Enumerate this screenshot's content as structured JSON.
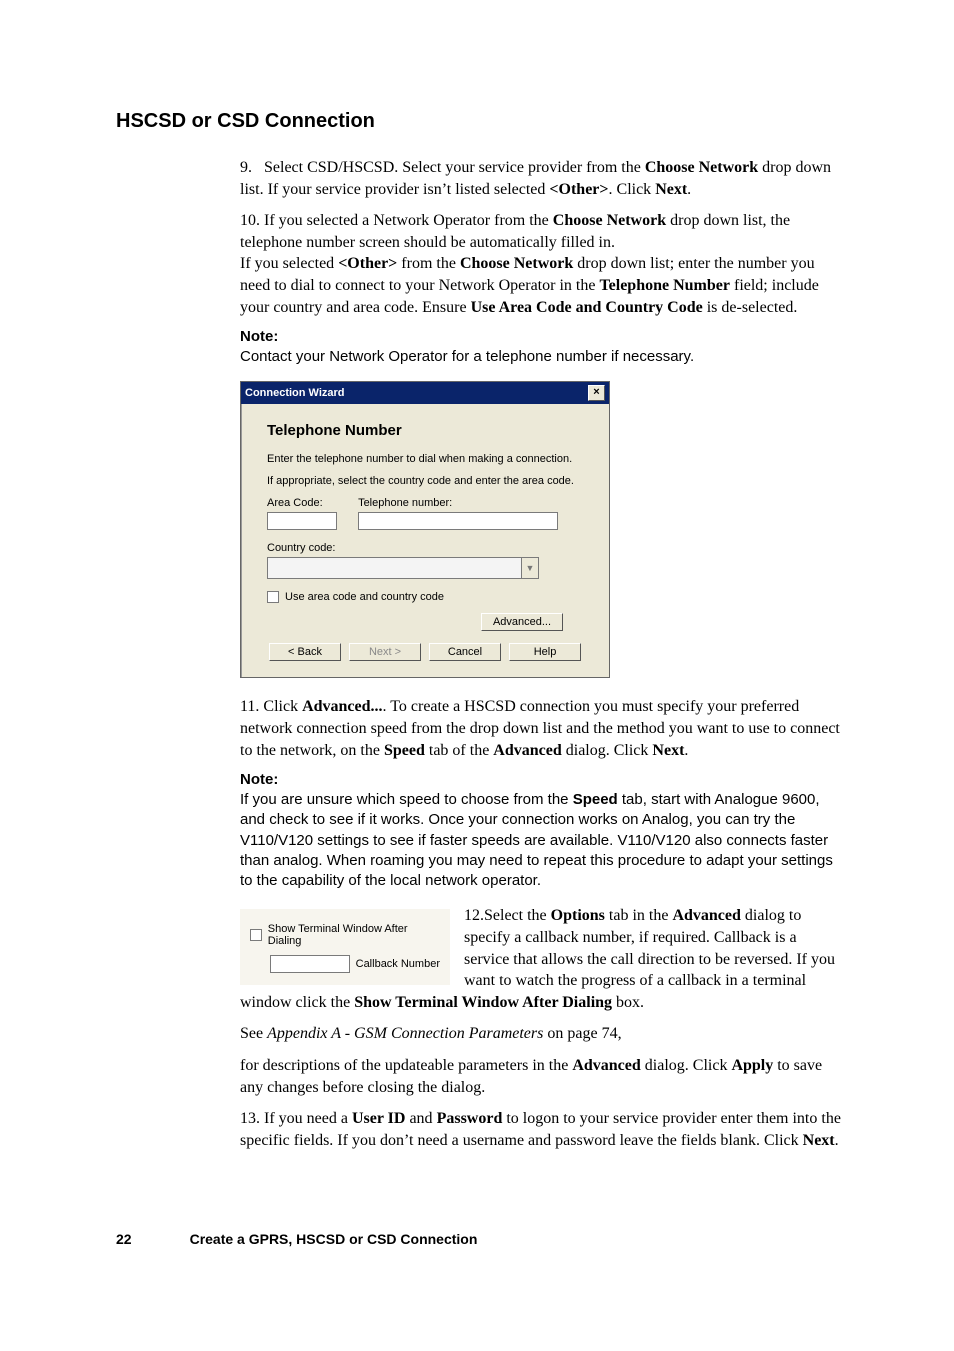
{
  "page_number": "22",
  "footer_title": "Create a GPRS, HSCSD or CSD Connection",
  "section_title": "HSCSD or CSD Connection",
  "step9_a": "Select CSD/HSCSD. Select your service provider from the ",
  "step9_b": "Choose Network",
  "step9_c": " drop down list. If your service provider isn’t listed selected ",
  "step9_d": "<Other>",
  "step9_e": ". Click ",
  "step9_f": "Next",
  "step9_g": ".",
  "step10_a": "If you selected a Network Operator from the ",
  "step10_b": "Choose Network",
  "step10_c": " drop down list, the telephone number screen should be automatically filled in.",
  "step10_d": "If you selected ",
  "step10_e": "<Other>",
  "step10_f": " from the ",
  "step10_g": "Choose Network",
  "step10_h": " drop down list; enter the number you need to dial to connect to your Network Operator in the ",
  "step10_i": "Telephone Number",
  "step10_j": " field; include your country and area code. Ensure ",
  "step10_k": "Use Area Code and Country Code",
  "step10_l": " is de-selected.",
  "note1_label": "Note:",
  "note1_body": "Contact your Network Operator for a telephone number if necessary.",
  "dialog": {
    "title": "Connection Wizard",
    "close": "×",
    "heading": "Telephone Number",
    "line1": "Enter the telephone number to dial when making a connection.",
    "line2": "If appropriate, select the country code and enter the area code.",
    "area_code_label": "Area Code:",
    "telephone_label": "Telephone number:",
    "country_label": "Country code:",
    "use_area_label": "Use area code and country code",
    "advanced_btn": "Advanced...",
    "back_btn": "< Back",
    "next_btn": "Next >",
    "cancel_btn": "Cancel",
    "help_btn": "Help"
  },
  "step11_a": "Click ",
  "step11_b": "Advanced...",
  "step11_c": ". To create a HSCSD connection you must specify your preferred network connection speed from the drop down list and the method you want to use to connect to the network, on the ",
  "step11_d": "Speed",
  "step11_e": " tab of the ",
  "step11_f": "Advanced",
  "step11_g": " dialog. Click ",
  "step11_h": "Next",
  "step11_i": ".",
  "note2_label": "Note:",
  "note2_body_a": "If you are unsure which speed to choose from the ",
  "note2_body_b": "Speed",
  "note2_body_c": " tab, start with Analogue 9600, and check to see if it works. Once your connection works on Analog, you can try the V110/V120 settings to see if faster speeds are available. V110/V120 also connects faster than analog. When roaming you may need to repeat this procedure to adapt your settings to the capability of the local network operator.",
  "options_snippet": {
    "show_terminal": "Show Terminal Window After Dialing",
    "callback_label": "Callback Number"
  },
  "step12_a": "12.Select the ",
  "step12_b": "Options",
  "step12_c": " tab in the ",
  "step12_d": "Advanced",
  "step12_e": " dialog to specify a callback number, if required. Callback is a service that allows the call direction to be reversed. If you want to watch the progress of a callback in a terminal window click the ",
  "step12_f": "Show Terminal Window After Dialing",
  "step12_g": " box.",
  "step12_h": "See ",
  "step12_i": "Appendix A - GSM Connection Parameters",
  "step12_j": " on page 74,",
  "step12_cont_a": "for descriptions of the updateable parameters in the ",
  "step12_cont_b": "Advanced",
  "step12_cont_c": " dialog. Click ",
  "step12_cont_d": "Apply",
  "step12_cont_e": " to save any changes before closing the dialog.",
  "step13_a": "If you need a ",
  "step13_b": "User ID",
  "step13_c": " and ",
  "step13_d": "Password",
  "step13_e": " to logon to your service provider enter them into the specific fields. If you don’t need a username and password leave the fields blank. Click ",
  "step13_f": "Next",
  "step13_g": "."
}
